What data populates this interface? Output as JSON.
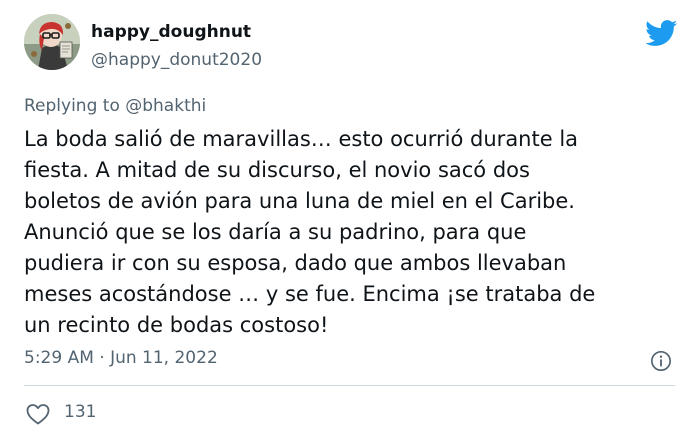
{
  "user": {
    "display_name": "happy_doughnut",
    "handle": "@happy_donut2020",
    "avatar_icon": "avatar-illustration"
  },
  "brand": {
    "icon": "twitter-bird-icon",
    "color": "#1d9bf0"
  },
  "reply": {
    "label": "Replying to @bhakthi"
  },
  "tweet": {
    "lines": [
      "La boda salió de maravillas… esto ocurrió durante la",
      "fiesta. A mitad de su discurso, el novio sacó dos",
      "boletos de avión para una luna de miel en el Caribe.",
      "Anunció que se los daría a su padrino, para que",
      "pudiera ir con su esposa, dado que ambos llevaban",
      "meses acostándose … y se fue. Encima ¡se trataba de",
      "un recinto de bodas costoso!"
    ]
  },
  "meta": {
    "timestamp": "5:29 AM · Jun 11, 2022",
    "info_icon": "info-icon"
  },
  "actions": {
    "like_icon": "heart-icon",
    "like_count": "131"
  }
}
